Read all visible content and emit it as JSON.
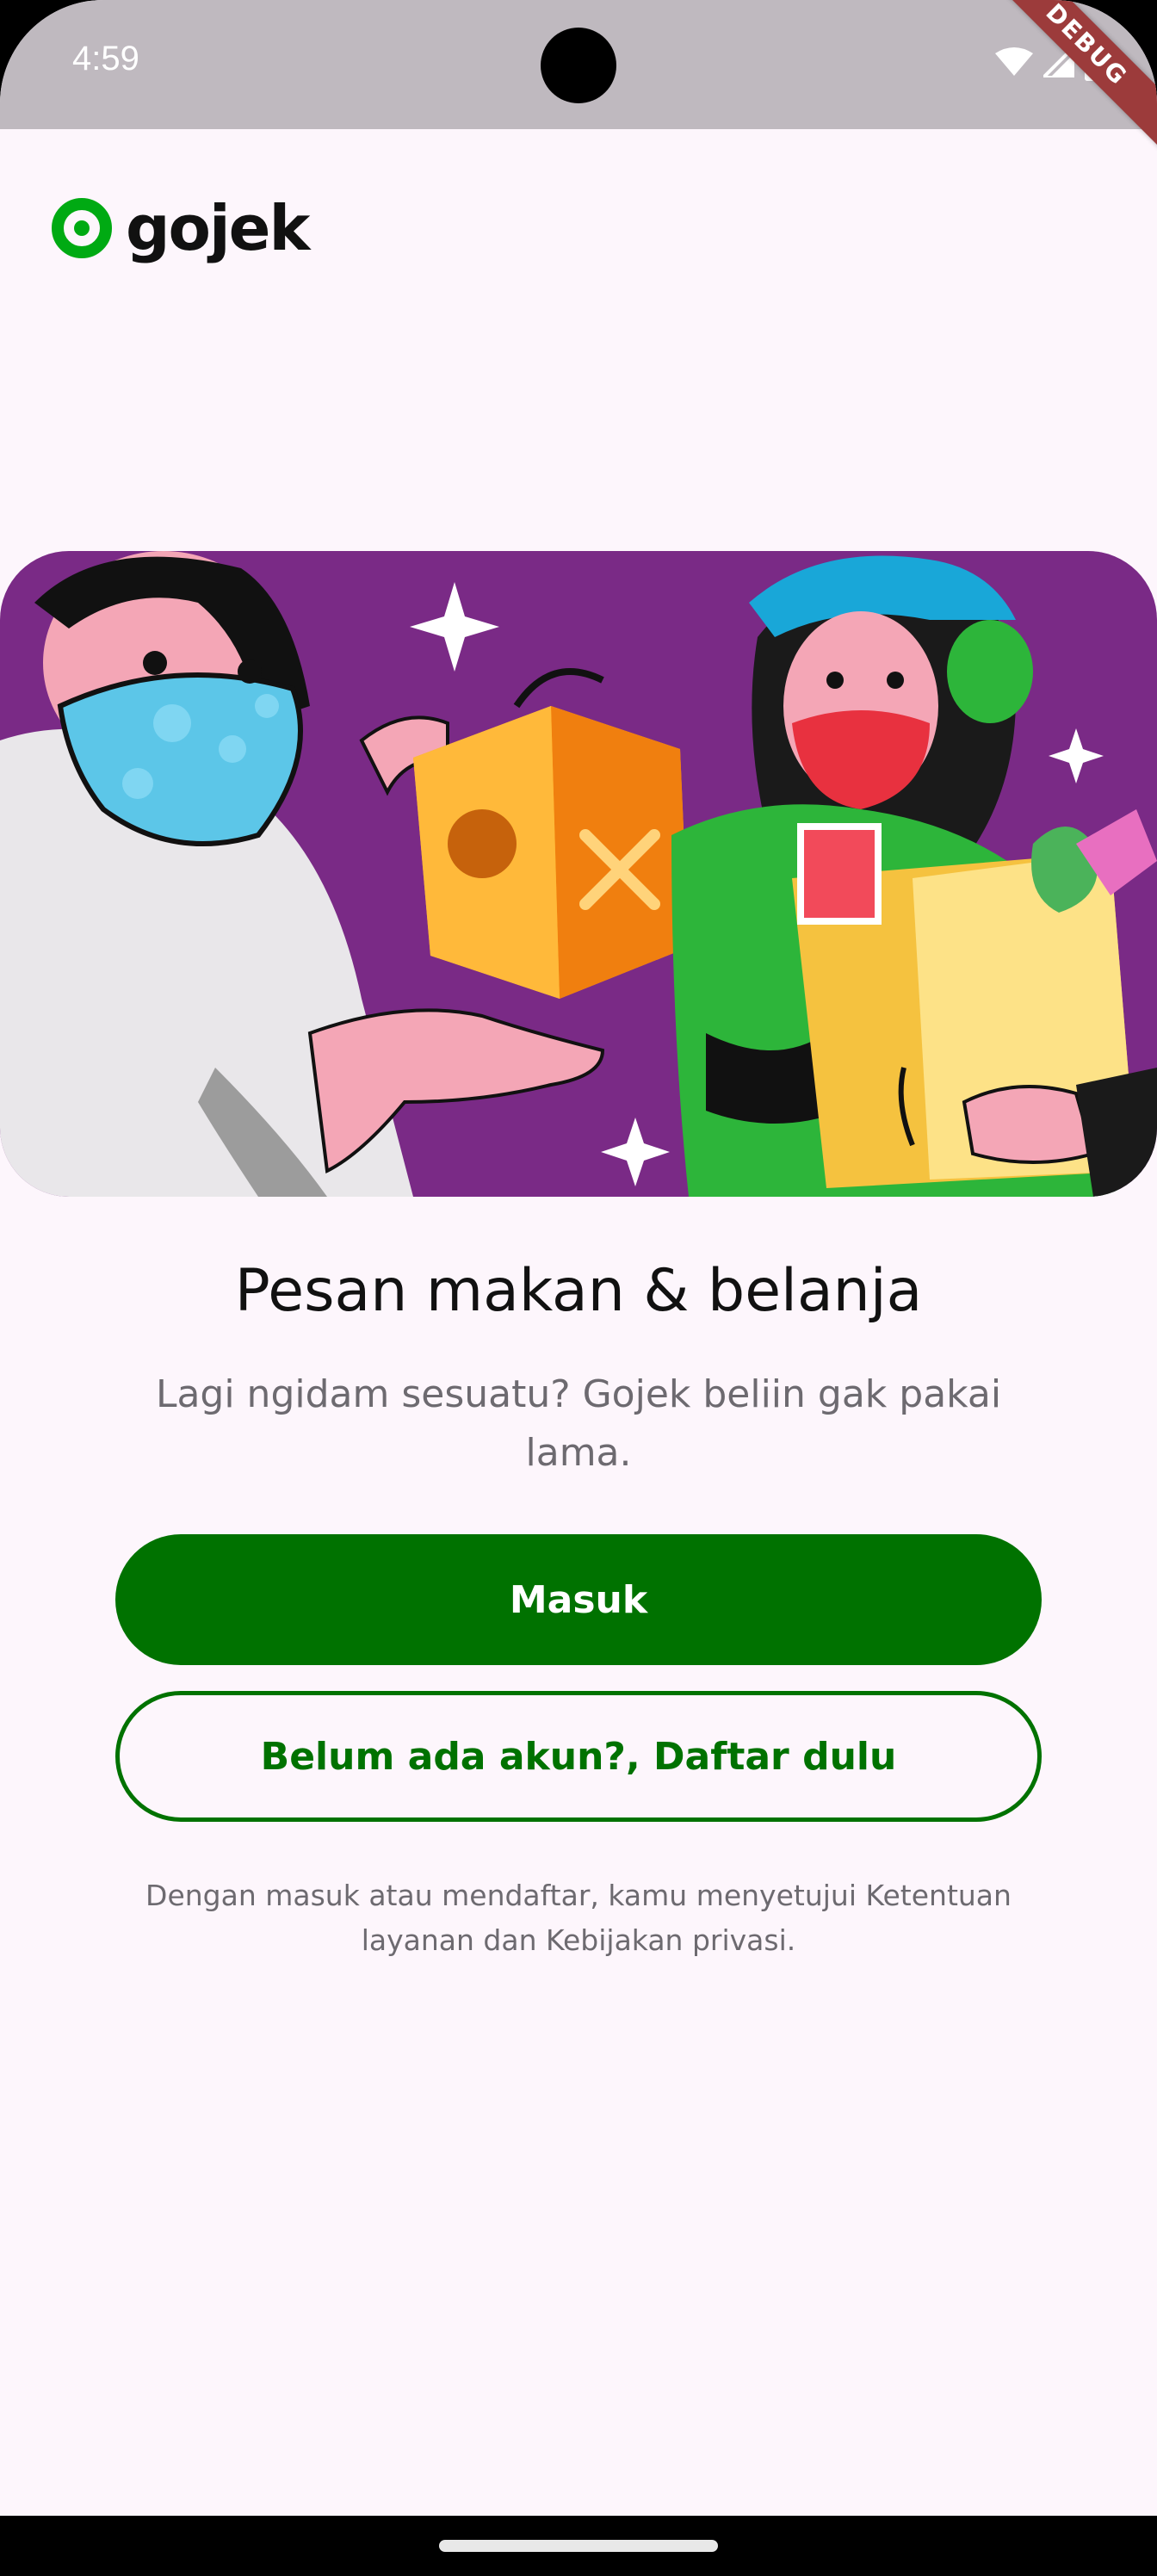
{
  "status_bar": {
    "time": "4:59",
    "icons": [
      "wifi-icon",
      "signal-icon",
      "battery-icon"
    ]
  },
  "debug_banner": "DEBUG",
  "logo": {
    "text": "gojek",
    "icon": "gojek-logo-icon",
    "color": "#00AA13"
  },
  "illustration": {
    "icon": "food-and-grocery-delivery-illustration"
  },
  "onboarding": {
    "title": "Pesan makan & belanja",
    "subtitle": "Lagi ngidam sesuatu? Gojek beliin gak pakai lama."
  },
  "actions": {
    "login_label": "Masuk",
    "register_label": "Belum ada akun?, Daftar dulu"
  },
  "terms_text": "Dengan masuk atau mendaftar, kamu menyetujui Ketentuan layanan dan Kebijakan privasi.",
  "colors": {
    "primary": "#007200",
    "background": "#FDF6FC",
    "status_bar": "#BFB9BF"
  }
}
